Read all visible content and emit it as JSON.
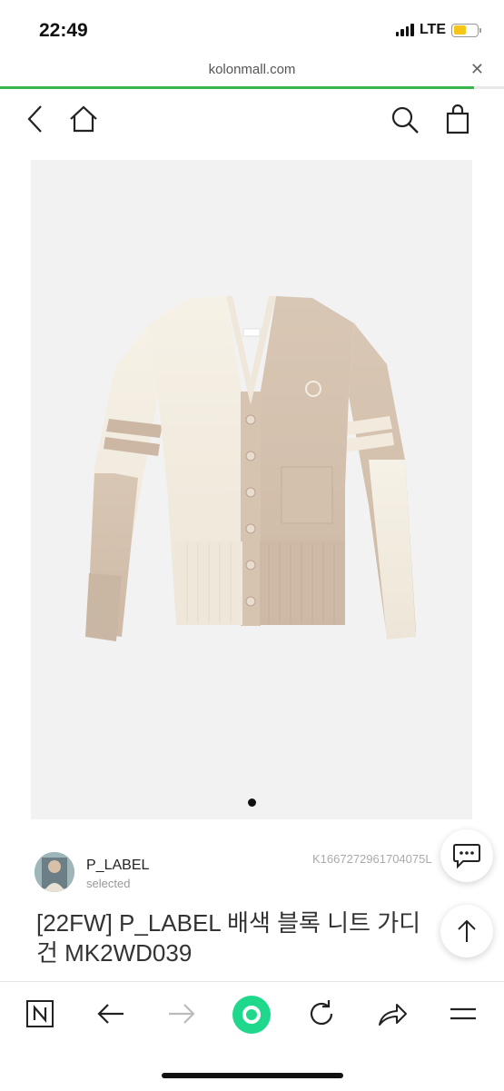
{
  "status": {
    "time": "22:49",
    "network": "LTE",
    "battery_level": 0.55
  },
  "browser": {
    "url": "kolonmall.com",
    "page_load_progress": 0.94
  },
  "header": {
    "back_icon": "chevron-left-icon",
    "home_icon": "home-icon",
    "search_icon": "search-icon",
    "cart_icon": "shopping-bag-icon"
  },
  "gallery": {
    "current_page": 1,
    "page_count": 1
  },
  "seller": {
    "name": "P_LABEL",
    "subtitle": "selected"
  },
  "product": {
    "code": "K1667272961704075L",
    "title": "[22FW] P_LABEL 배색 블록 니트 가디건 MK2WD039"
  },
  "fabs": {
    "chat_icon": "chat-bubble-icon",
    "top_icon": "arrow-up-icon"
  },
  "toolbar": {
    "items": [
      "naver-n-icon",
      "arrow-left-icon",
      "arrow-right-icon",
      "green-home-icon",
      "refresh-icon",
      "share-icon",
      "menu-icon"
    ]
  },
  "colors": {
    "accent_green": "#3ab54a",
    "naver_green": "#1fd88c"
  }
}
